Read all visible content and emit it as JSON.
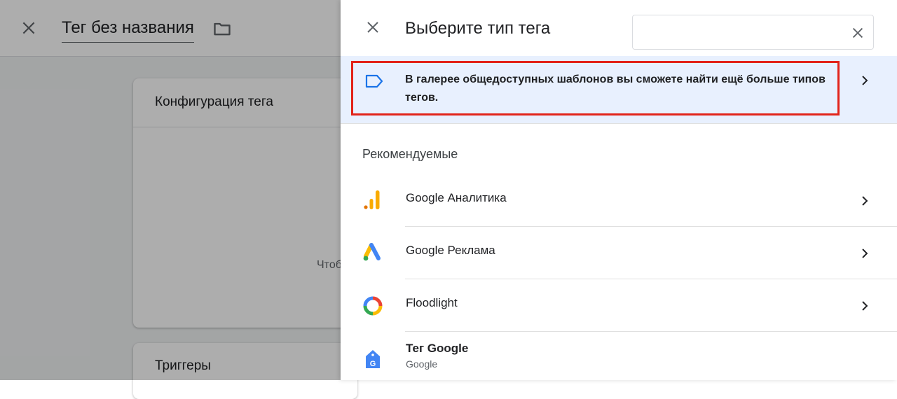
{
  "background": {
    "title": "Тег без названия",
    "card_title": "Конфигурация тега",
    "card_hint": "Чтобы",
    "triggers_title": "Триггеры"
  },
  "panel": {
    "title": "Выберите тип тега",
    "search": {
      "value": "",
      "placeholder": ""
    },
    "banner": {
      "text": "В галерее общедоступных шаблонов вы сможете найти ещё больше типов тегов."
    },
    "section_label": "Рекомендуемые",
    "items": [
      {
        "label": "Google Аналитика",
        "icon": "google-analytics-icon"
      },
      {
        "label": "Google Реклама",
        "icon": "google-ads-icon"
      },
      {
        "label": "Floodlight",
        "icon": "floodlight-icon"
      },
      {
        "label": "Тег Google",
        "sublabel": "Google",
        "icon": "google-tag-icon"
      }
    ]
  },
  "colors": {
    "highlight_border": "#e2231a",
    "banner_bg": "#e8f0fe",
    "banner_icon": "#1a73e8"
  }
}
